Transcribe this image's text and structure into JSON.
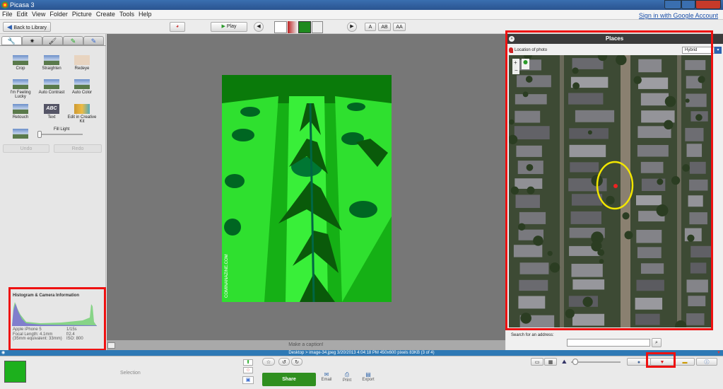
{
  "window": {
    "title": "Picasa 3"
  },
  "menu": {
    "items": [
      "File",
      "Edit",
      "View",
      "Folder",
      "Picture",
      "Create",
      "Tools",
      "Help"
    ],
    "signin": "Sign in with Google Account"
  },
  "toolbar": {
    "back": "Back to Library",
    "play": "Play",
    "text_a": "A",
    "text_ab": "AB",
    "text_aa": "AA"
  },
  "tools": {
    "row1": [
      "Crop",
      "Straighten",
      "Redeye"
    ],
    "row2": [
      "I'm Feeling Lucky",
      "Auto Contrast",
      "Auto Color"
    ],
    "row3": [
      "Retouch",
      "Text",
      "Edit in Creative Kit"
    ],
    "fill_light": "Fill Light",
    "undo": "Undo",
    "redo": "Redo",
    "text_glyph": "ABC"
  },
  "histogram": {
    "title": "Histogram & Camera Information",
    "camera": "Apple iPhone 5",
    "shutter": "1/15s",
    "focal": "Focal Length: 4.1mm",
    "aperture": "f/2.4",
    "equiv": "(35mm equivalent:  33mm)",
    "iso": "ISO: 800"
  },
  "photo": {
    "watermark": "COMINANAZINE.COM"
  },
  "caption": {
    "placeholder": "Make a caption!"
  },
  "places": {
    "title": "Places",
    "location_label": "Location of photo",
    "map_type": "Hybrid",
    "search_label": "Search for an address:",
    "search_value": ""
  },
  "status": {
    "text": "Desktop > image-34.jpeg    3/20/2013 4:04:18 PM    450x600 pixels    83KB    (3 of 4)"
  },
  "bottom": {
    "selection": "Selection",
    "share": "Share",
    "email": "Email",
    "print": "Print",
    "export": "Export"
  },
  "colors": {
    "accent_green": "#2f8f1f",
    "highlight_red": "#e11111",
    "places_header": "#3b3b3b"
  }
}
